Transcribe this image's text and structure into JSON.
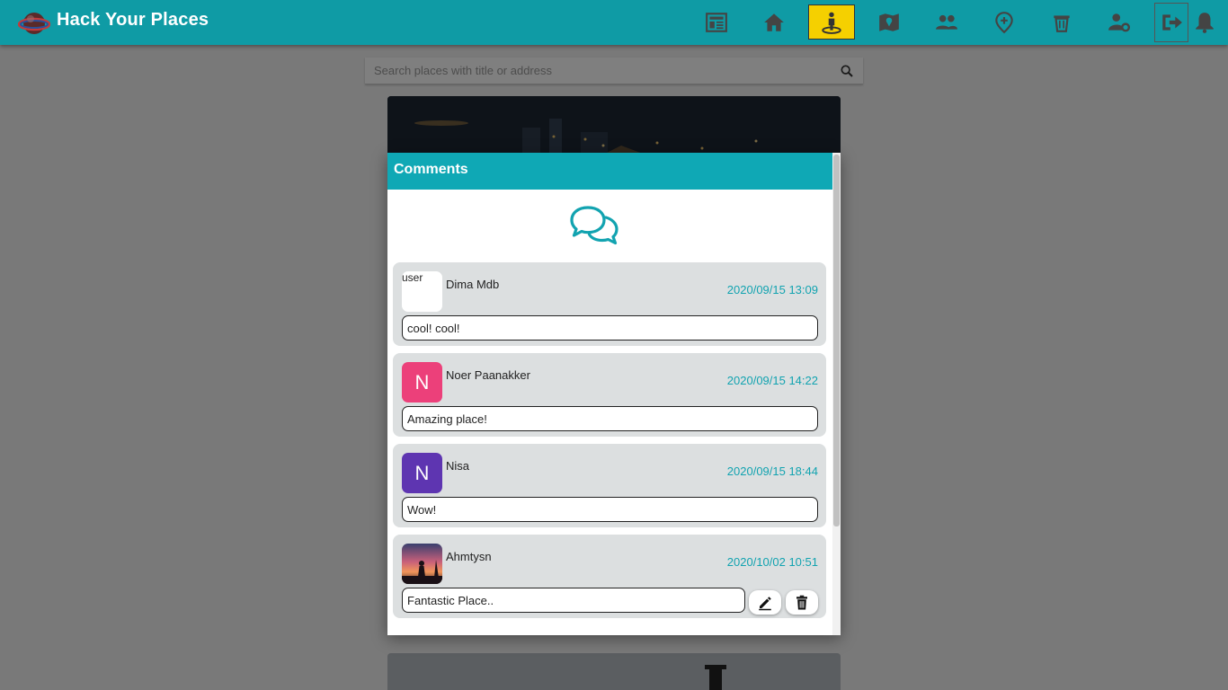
{
  "app": {
    "brand": "Hack Your Places"
  },
  "nav": {
    "items": [
      {
        "icon": "newspaper-icon"
      },
      {
        "icon": "home-icon"
      },
      {
        "icon": "person-pin-icon"
      },
      {
        "icon": "map-icon"
      },
      {
        "icon": "people-icon"
      },
      {
        "icon": "add-location-icon"
      },
      {
        "icon": "trash-bin-icon"
      },
      {
        "icon": "user-settings-icon"
      },
      {
        "icon": "logout-icon"
      },
      {
        "icon": "bell-icon"
      }
    ],
    "active_color": "#f5d000",
    "bar_color": "#0f9ba5"
  },
  "search": {
    "placeholder": "Search places with title or address",
    "value": ""
  },
  "modal": {
    "title": "Comments",
    "header_color": "#0fa8b5",
    "comments": [
      {
        "user": "Dima Mdb",
        "avatar_alt": "user",
        "date": "2020/09/15 13:09",
        "text": "cool! cool!"
      },
      {
        "user": "Noer Paanakker",
        "avatar_letter": "N",
        "avatar_color": "#ec407a",
        "date": "2020/09/15 14:22",
        "text": "Amazing place!"
      },
      {
        "user": "Nisa",
        "avatar_letter": "N",
        "avatar_color": "#5e35b1",
        "date": "2020/09/15 18:44",
        "text": "Wow!"
      },
      {
        "user": "Ahmtysn",
        "date": "2020/10/02 10:51",
        "text": "Fantastic Place..",
        "editable": true
      }
    ]
  }
}
